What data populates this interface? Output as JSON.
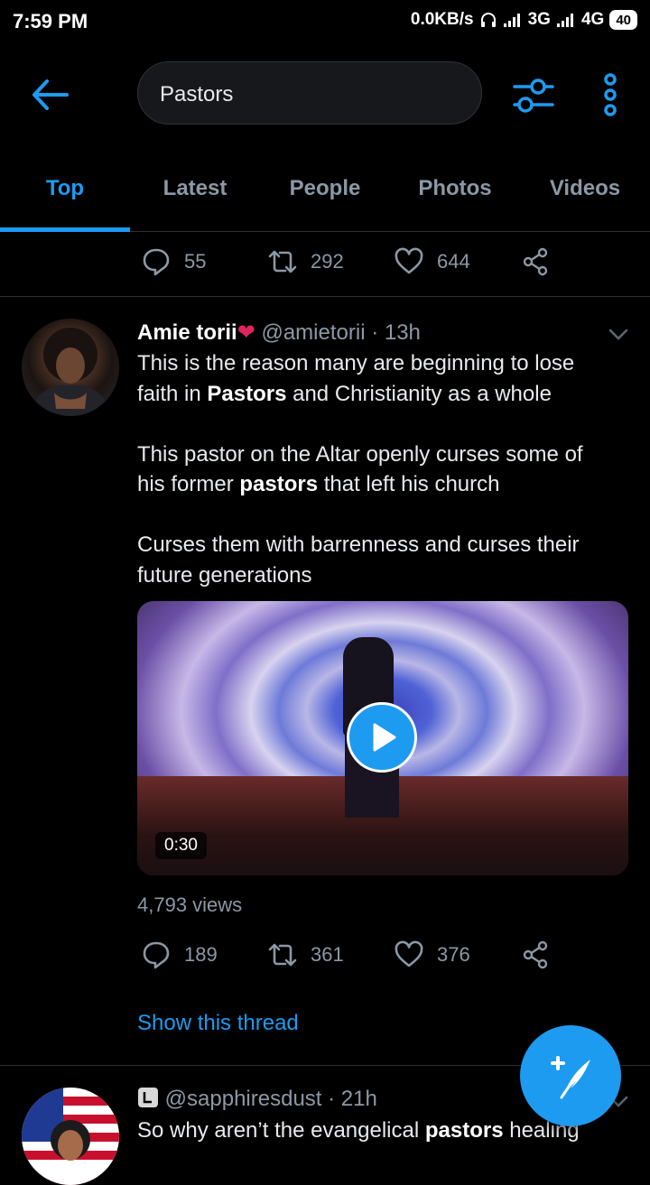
{
  "status_bar": {
    "time": "7:59 PM",
    "net_speed": "0.0KB/s",
    "network1": "3G",
    "network2": "4G",
    "battery": "40"
  },
  "search": {
    "query": "Pastors"
  },
  "tabs": [
    {
      "label": "Top",
      "active": true
    },
    {
      "label": "Latest",
      "active": false
    },
    {
      "label": "People",
      "active": false
    },
    {
      "label": "Photos",
      "active": false
    },
    {
      "label": "Videos",
      "active": false
    }
  ],
  "prev_tweet_actions": {
    "replies": "55",
    "retweets": "292",
    "likes": "644"
  },
  "tweet1": {
    "name": "Amie torii",
    "handle": "@amietorii",
    "time": "· 13h",
    "text_lines": [
      [
        "This is the reason many are beginning to lose"
      ],
      [
        "faith in ",
        "Pastors",
        " and Christianity as a whole"
      ],
      [
        ""
      ],
      [
        "This pastor on the Altar openly curses some of"
      ],
      [
        "his former ",
        "pastors",
        " that left his church"
      ],
      [
        ""
      ],
      [
        "Curses them with barrenness and curses their"
      ],
      [
        "future generations"
      ]
    ],
    "video_duration": "0:30",
    "views": "4,793 views",
    "replies": "189",
    "retweets": "361",
    "likes": "376",
    "show_thread": "Show this thread"
  },
  "tweet2": {
    "handle": "@sapphiresdust",
    "time": "· 21h",
    "text_pre": "So why aren’t the evangelical ",
    "text_bold": "pastors",
    "text_post": " healing"
  },
  "colors": {
    "accent": "#1d9bf0",
    "background": "#000000",
    "muted": "#8b98a5",
    "heart": "#e0245e"
  }
}
